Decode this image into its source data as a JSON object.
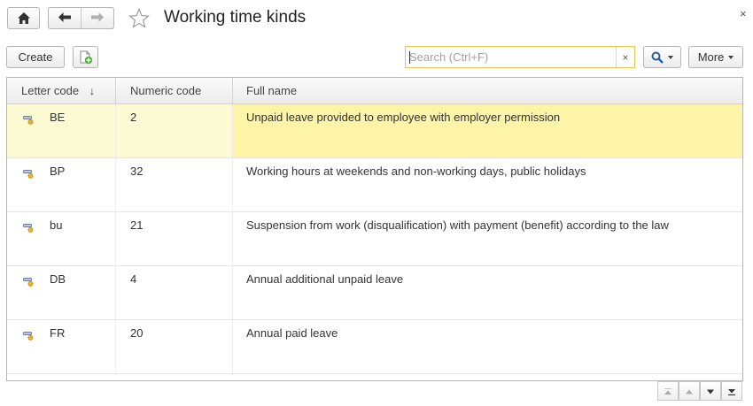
{
  "window": {
    "title": "Working time kinds",
    "close_symbol": "×"
  },
  "toolbar": {
    "create_label": "Create",
    "search_placeholder": "Search (Ctrl+F)",
    "search_clear_symbol": "×",
    "more_label": "More"
  },
  "table": {
    "columns": [
      "Letter code",
      "Numeric code",
      "Full name"
    ],
    "sort_indicator": "↓",
    "rows": [
      {
        "letter": "BE",
        "numeric": "2",
        "full_name": "Unpaid leave provided to employee with employer permission",
        "selected": true
      },
      {
        "letter": "BP",
        "numeric": "32",
        "full_name": "Working hours at weekends and non-working days, public holidays",
        "selected": false
      },
      {
        "letter": "bu",
        "numeric": "21",
        "full_name": "Suspension from work (disqualification) with payment (benefit) according to the law",
        "selected": false
      },
      {
        "letter": "DB",
        "numeric": "4",
        "full_name": "Annual additional unpaid leave",
        "selected": false
      },
      {
        "letter": "FR",
        "numeric": "20",
        "full_name": "Annual paid leave",
        "selected": false
      }
    ]
  },
  "icons": {
    "home": "home-icon",
    "back": "arrow-left-icon",
    "forward": "arrow-right-icon",
    "favorite": "star-outline-icon",
    "add_copy": "add-document-icon",
    "search": "magnifier-icon",
    "row_item": "catalog-item-icon",
    "scroll_top": "scroll-to-top-icon",
    "scroll_up": "scroll-up-icon",
    "scroll_down": "scroll-down-icon",
    "scroll_bottom": "scroll-to-bottom-icon"
  },
  "colors": {
    "selected_row": "#fdf4a8",
    "selected_row_left": "#fdfbd3",
    "search_focus_border": "#e6c64a"
  }
}
